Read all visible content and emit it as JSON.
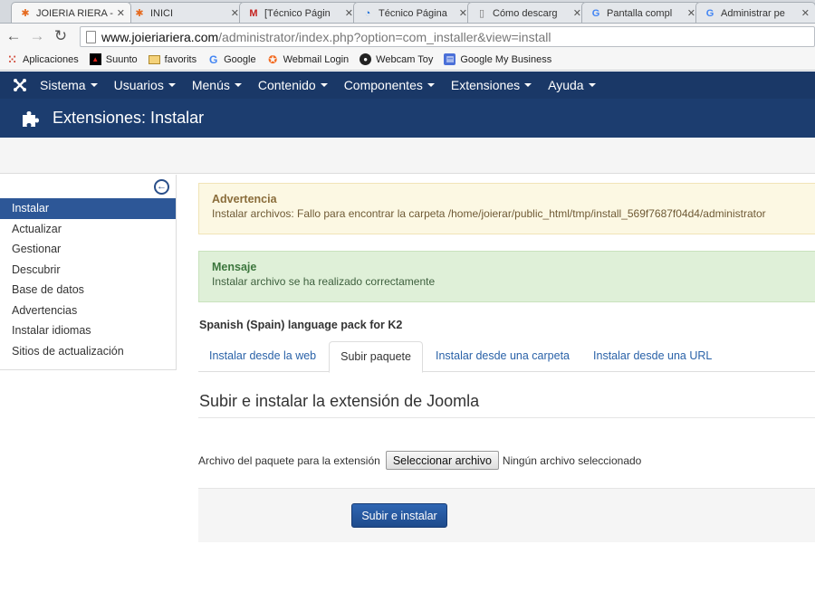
{
  "browser": {
    "tabs": [
      {
        "title": "JOIERIA RIERA - ",
        "favicon": "joomla-favicon",
        "active": true
      },
      {
        "title": "INICI",
        "favicon": "joomla-favicon",
        "active": false
      },
      {
        "title": "[Técnico Págin",
        "favicon": "gmail-favicon",
        "active": false
      },
      {
        "title": "Técnico Página",
        "favicon": "chat-favicon",
        "active": false
      },
      {
        "title": "Cómo descarg",
        "favicon": "page-favicon",
        "active": false
      },
      {
        "title": "Pantalla compl",
        "favicon": "google-favicon",
        "active": false
      },
      {
        "title": "Administrar pe",
        "favicon": "google-favicon",
        "active": false
      }
    ],
    "url_host": "www.joieriariera.com",
    "url_path": "/administrator/index.php?option=com_installer&view=install",
    "bookmarks": [
      {
        "label": "Aplicaciones",
        "icon": "apps-grid-icon"
      },
      {
        "label": "Suunto",
        "icon": "suunto-icon"
      },
      {
        "label": "favorits",
        "icon": "folder-icon"
      },
      {
        "label": "Google",
        "icon": "google-icon"
      },
      {
        "label": "Webmail Login",
        "icon": "webmail-icon"
      },
      {
        "label": "Webcam Toy",
        "icon": "webcam-icon"
      },
      {
        "label": "Google My Business",
        "icon": "business-icon"
      }
    ]
  },
  "nav": {
    "menus": [
      "Sistema",
      "Usuarios",
      "Menús",
      "Contenido",
      "Componentes",
      "Extensiones",
      "Ayuda"
    ]
  },
  "header": {
    "title": "Extensiones: Instalar"
  },
  "sidebar": {
    "items": [
      {
        "label": "Instalar",
        "active": true
      },
      {
        "label": "Actualizar",
        "active": false
      },
      {
        "label": "Gestionar",
        "active": false
      },
      {
        "label": "Descubrir",
        "active": false
      },
      {
        "label": "Base de datos",
        "active": false
      },
      {
        "label": "Advertencias",
        "active": false
      },
      {
        "label": "Instalar idiomas",
        "active": false
      },
      {
        "label": "Sitios de actualización",
        "active": false
      }
    ]
  },
  "alerts": {
    "warning": {
      "heading": "Advertencia",
      "text": "Instalar archivos: Fallo para encontrar la carpeta /home/joierar/public_html/tmp/install_569f7687f04d4/administrator"
    },
    "message": {
      "heading": "Mensaje",
      "text": "Instalar archivo se ha realizado correctamente"
    }
  },
  "main": {
    "package_title": "Spanish (Spain) language pack for K2",
    "tabs": [
      {
        "label": "Instalar desde la web",
        "active": false
      },
      {
        "label": "Subir paquete",
        "active": true
      },
      {
        "label": "Instalar desde una carpeta",
        "active": false
      },
      {
        "label": "Instalar desde una URL",
        "active": false
      }
    ],
    "section_title": "Subir e instalar la extensión de Joomla",
    "file_label": "Archivo del paquete para la extensión",
    "file_button": "Seleccionar archivo",
    "file_status": "Ningún archivo seleccionado",
    "submit_label": "Subir e instalar"
  },
  "colors": {
    "nav_bg": "#1a3867",
    "title_bg": "#1c3d6f",
    "sidebar_active": "#2d5797",
    "warning_bg": "#fcf8e3",
    "success_bg": "#dff0d8",
    "primary_button": "#2f66b3"
  }
}
